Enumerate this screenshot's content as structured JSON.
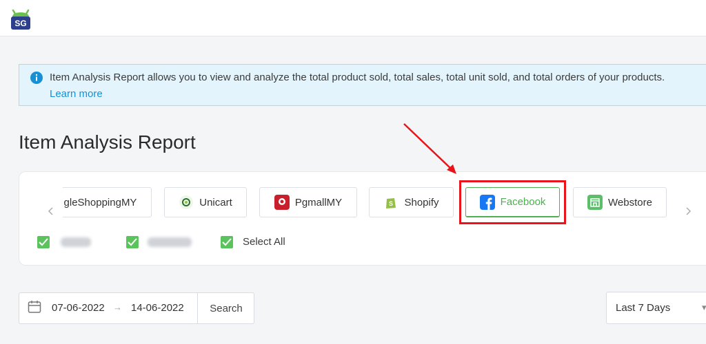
{
  "logo": {
    "text": "SG"
  },
  "info_banner": {
    "text": "Item Analysis Report allows you to view and analyze the total product sold, total sales, total unit sold, and total orders of your products.",
    "link": "Learn more"
  },
  "page_title": "Item Analysis Report",
  "channels": [
    {
      "label": "gleShoppingMY",
      "icon": "google-shopping-icon"
    },
    {
      "label": "Unicart",
      "icon": "unicart-icon"
    },
    {
      "label": "PgmallMY",
      "icon": "pgmall-icon"
    },
    {
      "label": "Shopify",
      "icon": "shopify-icon"
    },
    {
      "label": "Facebook",
      "icon": "facebook-icon",
      "selected": true
    },
    {
      "label": "Webstore",
      "icon": "webstore-icon"
    }
  ],
  "checkboxes": {
    "select_all": "Select All"
  },
  "date_range": {
    "start": "07-06-2022",
    "separator": "→",
    "end": "14-06-2022",
    "search": "Search"
  },
  "range_select": {
    "value": "Last 7 Days"
  },
  "colors": {
    "accent_green": "#4caf50",
    "annotation_red": "#e8141a",
    "info_bg": "#e3f4fc"
  }
}
